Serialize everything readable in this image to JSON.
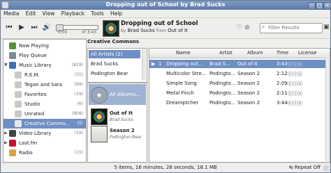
{
  "window": {
    "title": "Dropping out of School by Brad Sucks"
  },
  "menu": [
    "Media",
    "Edit",
    "View",
    "Playback",
    "Tools",
    "Help"
  ],
  "player": {
    "elapsed": "0:00",
    "total": "of 3:43",
    "track_title": "Dropping out of School",
    "by": "by",
    "artist": "Brad Sucks",
    "from": "from",
    "album": "Out of It"
  },
  "search": {
    "placeholder": "Filter Results"
  },
  "sources": [
    {
      "label": "Now Playing",
      "count": "",
      "icon_color": "#5c8f3a"
    },
    {
      "label": "Play Queue",
      "count": "",
      "icon_color": "#7d8a96"
    },
    {
      "label": "Music Library",
      "count": "(819)",
      "icon_color": "#3e6fb5"
    },
    {
      "label": "R.E.M.",
      "count": "(31)",
      "icon_color": "#c9c9c9"
    },
    {
      "label": "Tegan and Sara",
      "count": "(69)",
      "icon_color": "#c9c9c9"
    },
    {
      "label": "Favorites",
      "count": "(19)",
      "icon_color": "#c9c9c9"
    },
    {
      "label": "Studio",
      "count": "(6)",
      "icon_color": "#c9c9c9"
    },
    {
      "label": "Unrated",
      "count": "(808)",
      "icon_color": "#c9c9c9"
    },
    {
      "label": "Creative Commo...",
      "count": "(5)",
      "icon_color": "#e8e8e8"
    },
    {
      "label": "Video Library",
      "count": "(19)",
      "icon_color": "#444444"
    },
    {
      "label": "Last.fm",
      "count": "",
      "icon_color": "#c8102e"
    },
    {
      "label": "Radio",
      "count": "(15)",
      "icon_color": "#d9a441"
    }
  ],
  "browser": {
    "heading": "Creative Commons",
    "artists": [
      "All Artists (2)",
      "Brad Sucks",
      "Podington Bear"
    ],
    "albums": [
      {
        "title": "All Albums...",
        "subtitle": ""
      },
      {
        "title": "Out of It",
        "subtitle": "Brad Sucks"
      },
      {
        "title": "Season 2",
        "subtitle": "Podington Bear"
      }
    ]
  },
  "tracklist": {
    "columns": [
      "Name",
      "Artist",
      "Album",
      "Time",
      "License"
    ],
    "rows": [
      {
        "num": "1",
        "name": "Dropping out...",
        "artist": "Brad S...",
        "album": "Out of It",
        "time": "3:43",
        "license": "ⓒⓘⓢ"
      },
      {
        "num": "",
        "name": "Multicolor Stre...",
        "artist": "Podingto...",
        "album": "Season 2",
        "time": "2:12",
        "license": "ⓒⓘⓢ"
      },
      {
        "num": "",
        "name": "Simple Song",
        "artist": "Podingto...",
        "album": "Season 2",
        "time": "2:09",
        "license": "ⓒⓘⓢ"
      },
      {
        "num": "",
        "name": "Metal Finch",
        "artist": "Podingto...",
        "album": "Season 2",
        "time": "2:11",
        "license": "ⓒⓘⓢ"
      },
      {
        "num": "",
        "name": "Dreamptcher",
        "artist": "Podingto...",
        "album": "Season 2",
        "time": "3:44",
        "license": "ⓒⓘⓢ"
      }
    ]
  },
  "status": {
    "summary": "5 items, 16 minutes, 28 seconds, 18.1 MB",
    "repeat": "Repeat Off"
  }
}
